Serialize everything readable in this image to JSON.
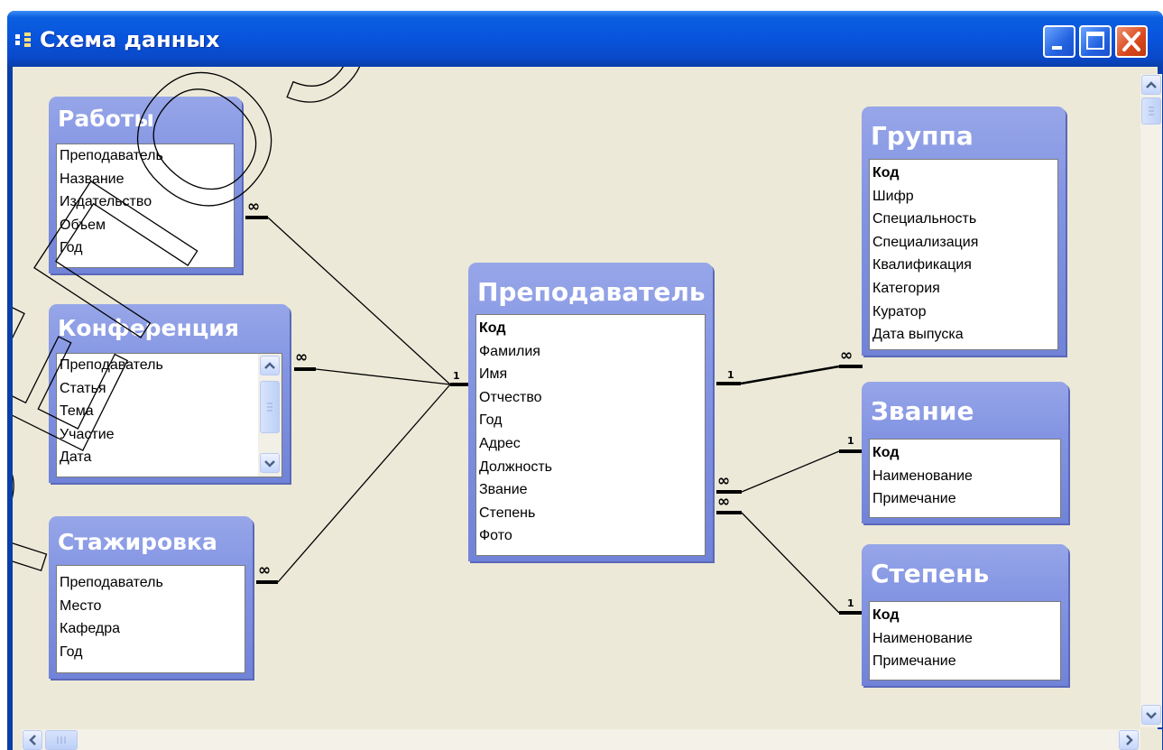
{
  "window": {
    "title": "Схема данных",
    "icon": "relationships-icon"
  },
  "tables": {
    "raboty": {
      "title": "Работы",
      "fields": [
        "Преподаватель",
        "Название",
        "Издательство",
        "Объем",
        "Год"
      ]
    },
    "konferenciya": {
      "title": "Конференция",
      "fields": [
        "Преподаватель",
        "Статья",
        "Тема",
        "Участие",
        "Дата"
      ]
    },
    "stazhirovka": {
      "title": "Стажировка",
      "fields": [
        "Преподаватель",
        "Место",
        "Кафедра",
        "Год"
      ]
    },
    "prepodavatel": {
      "title": "Преподаватель",
      "fields": [
        "Код",
        "Фамилия",
        "Имя",
        "Отчество",
        "Год",
        "Адрес",
        "Должность",
        "Звание",
        "Степень",
        "Фото"
      ]
    },
    "gruppa": {
      "title": "Группа",
      "fields": [
        "Код",
        "Шифр",
        "Специальность",
        "Специализация",
        "Квалификация",
        "Категория",
        "Куратор",
        "Дата выпуска"
      ]
    },
    "zvanie": {
      "title": "Звание",
      "fields": [
        "Код",
        "Наименование",
        "Примечание"
      ]
    },
    "stepen": {
      "title": "Степень",
      "fields": [
        "Код",
        "Наименование",
        "Примечание"
      ]
    }
  },
  "relationships": {
    "one_label": "1",
    "many_label": "∞"
  },
  "watermark": "РЕПОЗИТОРИЙ"
}
